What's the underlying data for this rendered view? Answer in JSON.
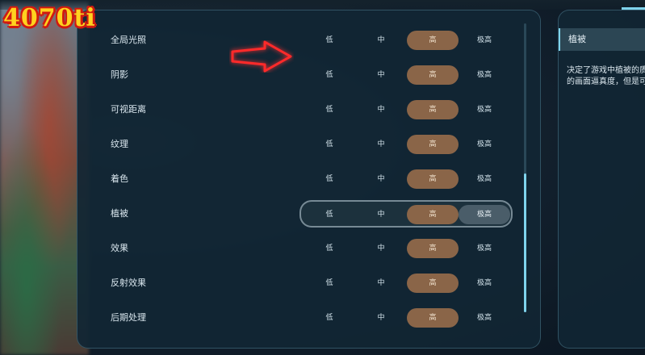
{
  "badge": "4070ti",
  "settings": [
    {
      "label": "全局光照",
      "options": [
        "低",
        "中",
        "高",
        "极高"
      ],
      "active": 2
    },
    {
      "label": "阴影",
      "options": [
        "低",
        "中",
        "高",
        "极高"
      ],
      "active": 2
    },
    {
      "label": "可视距离",
      "options": [
        "低",
        "中",
        "高",
        "极高"
      ],
      "active": 2
    },
    {
      "label": "纹理",
      "options": [
        "低",
        "中",
        "高",
        "极高"
      ],
      "active": 2
    },
    {
      "label": "着色",
      "options": [
        "低",
        "中",
        "高",
        "极高"
      ],
      "active": 2
    },
    {
      "label": "植被",
      "options": [
        "低",
        "中",
        "高",
        "极高"
      ],
      "active": 2,
      "selected": true,
      "hover": 3
    },
    {
      "label": "效果",
      "options": [
        "低",
        "中",
        "高",
        "极高"
      ],
      "active": 2
    },
    {
      "label": "反射效果",
      "options": [
        "低",
        "中",
        "高",
        "极高"
      ],
      "active": 2
    },
    {
      "label": "后期处理",
      "options": [
        "低",
        "中",
        "高",
        "极高"
      ],
      "active": 2
    }
  ],
  "description_panel": {
    "title": "植被",
    "lines": [
      "决定了游戏中植被的质",
      "的画面逼真度，但是可"
    ]
  },
  "colors": {
    "active_option": "#8a6548",
    "hover_option": "#4a5d69",
    "accent": "#7fd3ec",
    "arrow": "#ff2a2a",
    "badge_fill": "#ffd21f",
    "badge_outline": "#d01a10"
  },
  "scroll": {
    "position_fraction": 0.52,
    "visible_fraction": 0.48
  }
}
